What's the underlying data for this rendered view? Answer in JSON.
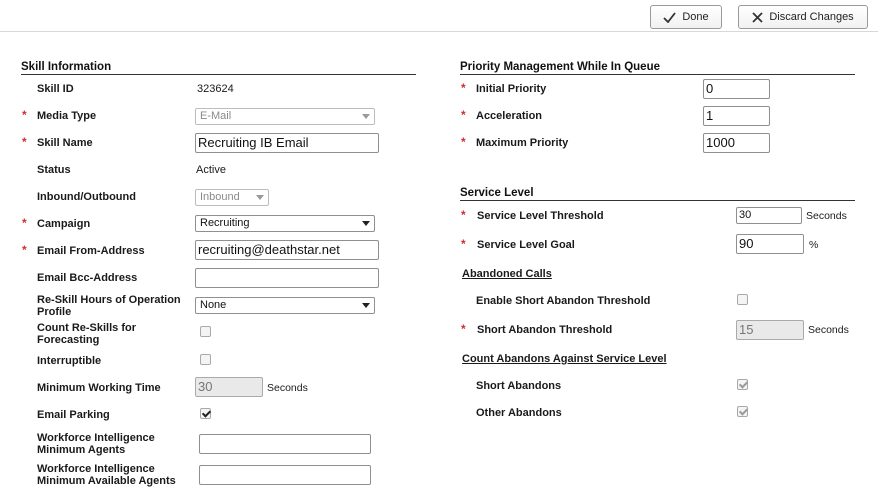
{
  "toolbar": {
    "done_label": "Done",
    "discard_label": "Discard Changes"
  },
  "skill_info": {
    "title": "Skill Information",
    "skill_id_label": "Skill ID",
    "skill_id_value": "323624",
    "media_type_label": "Media Type",
    "media_type_value": "E-Mail",
    "skill_name_label": "Skill Name",
    "skill_name_value": "Recruiting IB Email",
    "status_label": "Status",
    "status_value": "Active",
    "direction_label": "Inbound/Outbound",
    "direction_value": "Inbound",
    "campaign_label": "Campaign",
    "campaign_value": "Recruiting",
    "email_from_label": "Email From-Address",
    "email_from_value": "recruiting@deathstar.net",
    "email_bcc_label": "Email Bcc-Address",
    "email_bcc_value": "",
    "reskill_hours_label_1": "Re-Skill Hours of Operation",
    "reskill_hours_label_2": "Profile",
    "reskill_hours_value": "None",
    "count_reskills_label_1": "Count Re-Skills for",
    "count_reskills_label_2": "Forecasting",
    "count_reskills_checked": false,
    "interruptible_label": "Interruptible",
    "interruptible_checked": false,
    "min_working_time_label": "Minimum Working Time",
    "min_working_time_value": "30",
    "min_working_time_unit": "Seconds",
    "email_parking_label": "Email Parking",
    "email_parking_checked": true,
    "wfi_min_agents_label_1": "Workforce Intelligence",
    "wfi_min_agents_label_2": "Minimum Agents",
    "wfi_min_agents_value": "",
    "wfi_min_avail_label_1": "Workforce Intelligence",
    "wfi_min_avail_label_2": "Minimum Available Agents",
    "wfi_min_avail_value": ""
  },
  "priority": {
    "title": "Priority Management While In Queue",
    "initial_label": "Initial Priority",
    "initial_value": "0",
    "acceleration_label": "Acceleration",
    "acceleration_value": "1",
    "max_label": "Maximum Priority",
    "max_value": "1000"
  },
  "service_level": {
    "title": "Service Level",
    "threshold_label": "Service Level Threshold",
    "threshold_value": "30",
    "threshold_unit": "Seconds",
    "goal_label": "Service Level Goal",
    "goal_value": "90",
    "goal_unit": "%",
    "abandoned_calls_heading": "Abandoned Calls",
    "enable_short_abandon_label": "Enable Short Abandon Threshold",
    "enable_short_abandon_checked": false,
    "short_abandon_threshold_label": "Short Abandon Threshold",
    "short_abandon_threshold_value": "15",
    "short_abandon_threshold_unit": "Seconds",
    "count_abandons_heading": "Count Abandons Against Service Level",
    "short_abandons_label": "Short Abandons",
    "short_abandons_checked": true,
    "other_abandons_label": "Other Abandons",
    "other_abandons_checked": true
  },
  "colors": {
    "required_marker": "#d03030",
    "disabled_field": "#e9e9e9"
  }
}
